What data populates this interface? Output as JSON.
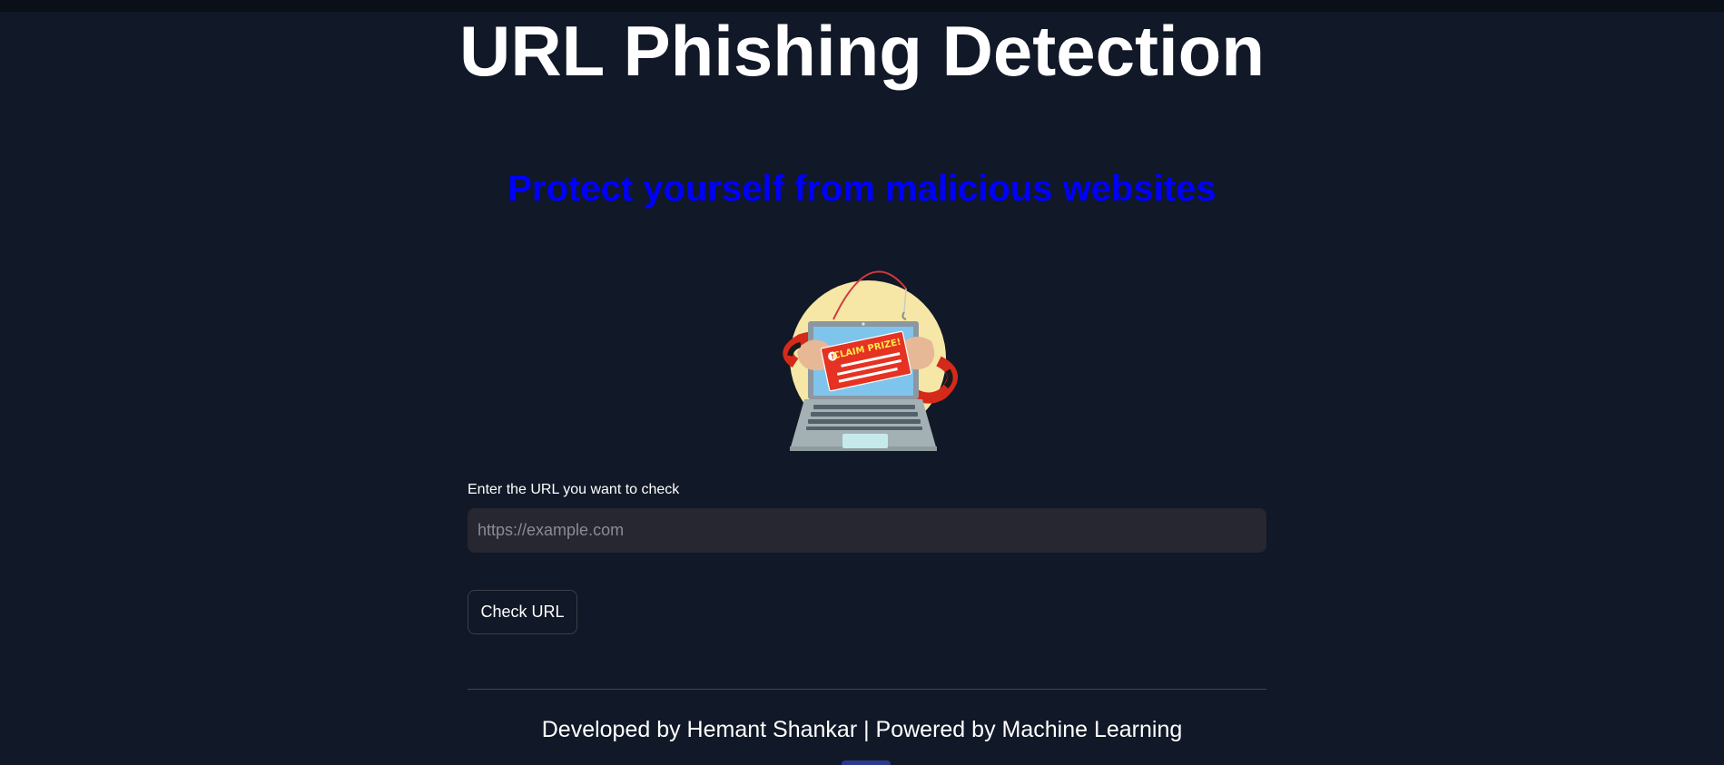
{
  "header": {
    "title": "URL Phishing Detection",
    "subtitle": "Protect yourself from malicious websites"
  },
  "hero_image": {
    "icon": "phishing-laptop-illustration",
    "sign_text": "CLAIM PRIZE!"
  },
  "form": {
    "label": "Enter the URL you want to check",
    "placeholder": "https://example.com",
    "value": "",
    "button_label": "Check URL"
  },
  "footer": {
    "text": "Developed by Hemant Shankar | Powered by Machine Learning"
  },
  "colors": {
    "background": "#111827",
    "subtitle": "#0000ff",
    "input_bg": "#262730",
    "text": "#ffffff"
  }
}
